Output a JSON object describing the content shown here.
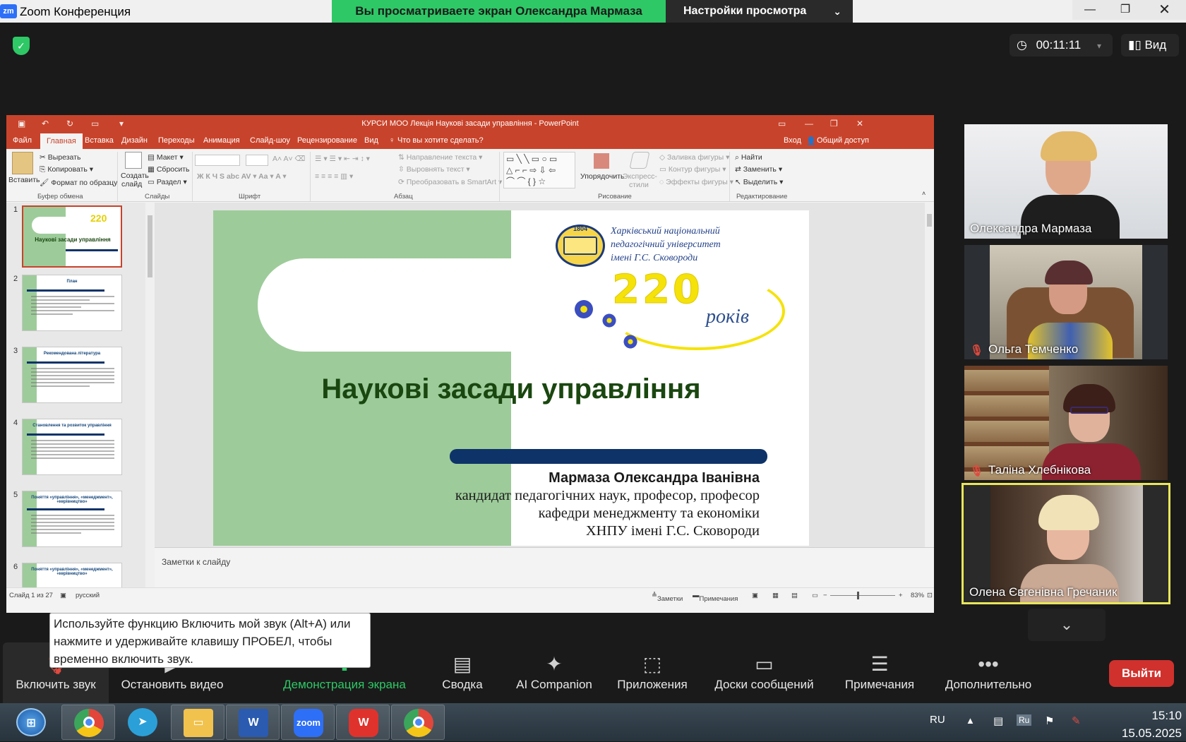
{
  "window": {
    "app_title": "Zoom Конференция",
    "app_icon": "zm",
    "share_banner": "Вы просматриваете экран Олександра Мармаза",
    "view_settings": "Настройки просмотра"
  },
  "header": {
    "timer": "00:11:11",
    "view_label": "Вид"
  },
  "ppt": {
    "window_title": "КУРСИ МОО Лекція Наукові засади управління - PowerPoint",
    "tabs": [
      "Файл",
      "Главная",
      "Вставка",
      "Дизайн",
      "Переходы",
      "Анимация",
      "Слайд-шоу",
      "Рецензирование",
      "Вид"
    ],
    "tell_me": "Что вы хотите сделать?",
    "signin": "Вход",
    "share": "Общий доступ",
    "ribbon": {
      "paste": "Вставить",
      "cut": "Вырезать",
      "copy": "Копировать",
      "format_painter": "Формат по образцу",
      "clipboard_group": "Буфер обмена",
      "new_slide_1": "Создать",
      "new_slide_2": "слайд",
      "layout": "Макет",
      "reset": "Сбросить",
      "section": "Раздел",
      "slides_group": "Слайды",
      "font_group": "Шрифт",
      "text_direction": "Направление текста",
      "align_text": "Выровнять текст",
      "smartart": "Преобразовать в SmartArt",
      "paragraph_group": "Абзац",
      "arrange": "Упорядочить",
      "quick_styles_1": "Экспресс-",
      "quick_styles_2": "стили",
      "shape_fill": "Заливка фигуры",
      "shape_outline": "Контур фигуры",
      "shape_effects": "Эффекты фигуры",
      "drawing_group": "Рисование",
      "find": "Найти",
      "replace": "Заменить",
      "select": "Выделить",
      "editing_group": "Редактирование"
    },
    "thumbnails": [
      {
        "num": "1",
        "title": "Наукові засади управління"
      },
      {
        "num": "2",
        "title": "План"
      },
      {
        "num": "3",
        "title": "Рекомендована література"
      },
      {
        "num": "4",
        "title": "Становлення та розвиток управління"
      },
      {
        "num": "5",
        "title": "Поняття «управління», «менеджмент», «керівництво»"
      },
      {
        "num": "6",
        "title": "Поняття «управління», «менеджмент», «керівництво»"
      }
    ],
    "slide": {
      "logo_line1": "Харківський національний",
      "logo_line2": "педагогічний університет",
      "logo_line3": "імені Г.С. Сковороди",
      "logo_year": "1804",
      "anniversary": "220",
      "years_word": "років",
      "title": "Наукові засади управління",
      "author": "Мармаза Олександра Іванівна",
      "aff1": "кандидат педагогічних наук, професор, професор",
      "aff2": "кафедри менеджменту та економіки",
      "aff3": "ХНПУ імені Г.С. Сковороди"
    },
    "notes_placeholder": "Заметки к слайду",
    "status": {
      "slide_count": "Слайд 1 из 27",
      "language": "русский",
      "notes": "Заметки",
      "comments": "Примечания",
      "zoom": "83%"
    }
  },
  "participants": [
    {
      "name": "Олександра Мармаза",
      "muted": false,
      "active": false
    },
    {
      "name": "Ольга Темченко",
      "muted": true,
      "active": false
    },
    {
      "name": "Таліна Хлебнікова",
      "muted": true,
      "active": false
    },
    {
      "name": "Олена Євгенівна Гречаник",
      "muted": false,
      "active": true
    }
  ],
  "tooltip": "Используйте функцию Включить мой звук (Alt+A) или нажмите и удерживайте клавишу ПРОБЕЛ, чтобы временно включить звук.",
  "toolbar": {
    "unmute": "Включить звук",
    "stop_video": "Остановить видео",
    "share": "Демонстрация экрана",
    "summary": "Сводка",
    "ai": "AI Companion",
    "apps": "Приложения",
    "whiteboards": "Доски сообщений",
    "notes": "Примечания",
    "more": "Дополнительно",
    "leave": "Выйти"
  },
  "taskbar": {
    "zoom_label": "zoom",
    "lang": "RU",
    "tray_lang": "Ru",
    "time": "15:10",
    "date": "15.05.2025"
  },
  "colors": {
    "share_green": "#2ec866",
    "ppt_red": "#c8432b",
    "slide_green": "#9dcc9a",
    "leave_red": "#d0312d",
    "active_speaker": "#e8e65b"
  }
}
